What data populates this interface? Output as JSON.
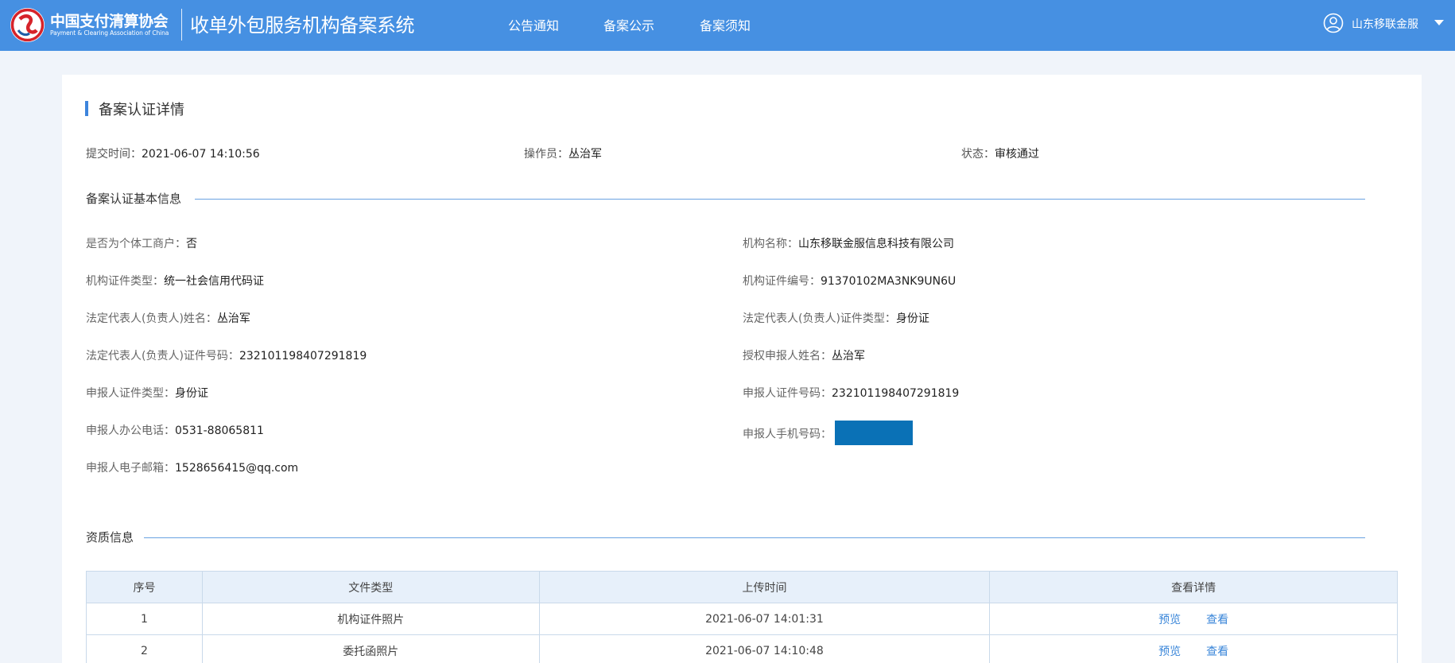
{
  "header": {
    "logo_cn": "中国支付清算协会",
    "logo_en": "Payment & Clearing Association of China",
    "system_title": "收单外包服务机构备案系统",
    "nav": [
      "公告通知",
      "备案公示",
      "备案须知"
    ],
    "user_name": "山东移联金服",
    "bg_color": "#4690e2"
  },
  "page": {
    "title": "备案认证详情",
    "meta": {
      "submit_time_label": "提交时间：",
      "submit_time": "2021-06-07 14:10:56",
      "operator_label": "操作员：",
      "operator": "丛治军",
      "status_label": "状态：",
      "status": "审核通过"
    }
  },
  "basic_info": {
    "title": "备案认证基本信息",
    "fields": {
      "is_individual": {
        "label": "是否为个体工商户：",
        "value": "否"
      },
      "org_name": {
        "label": "机构名称：",
        "value": "山东移联金服信息科技有限公司"
      },
      "org_cert_type": {
        "label": "机构证件类型：",
        "value": "统一社会信用代码证"
      },
      "org_cert_no": {
        "label": "机构证件编号：",
        "value": "91370102MA3NK9UN6U"
      },
      "legal_rep_name": {
        "label": "法定代表人(负责人)姓名：",
        "value": "丛治军"
      },
      "legal_rep_cert_type": {
        "label": "法定代表人(负责人)证件类型：",
        "value": "身份证"
      },
      "legal_rep_cert_no": {
        "label": "法定代表人(负责人)证件号码：",
        "value": "232101198407291819"
      },
      "authorized_reporter": {
        "label": "授权申报人姓名：",
        "value": "丛治军"
      },
      "reporter_cert_type": {
        "label": "申报人证件类型：",
        "value": "身份证"
      },
      "reporter_cert_no": {
        "label": "申报人证件号码：",
        "value": "232101198407291819"
      },
      "reporter_office_phone": {
        "label": "申报人办公电话：",
        "value": "0531-88065811"
      },
      "reporter_mobile": {
        "label": "申报人手机号码：",
        "value": ""
      },
      "reporter_email": {
        "label": "申报人电子邮箱：",
        "value": "1528656415@qq.com"
      }
    }
  },
  "qualification": {
    "title": "资质信息",
    "columns": [
      "序号",
      "文件类型",
      "上传时间",
      "查看详情"
    ],
    "rows": [
      {
        "no": "1",
        "type": "机构证件照片",
        "time": "2021-06-07 14:01:31",
        "preview": "预览",
        "view": "查看"
      },
      {
        "no": "2",
        "type": "委托函照片",
        "time": "2021-06-07 14:10:48",
        "preview": "预览",
        "view": "查看"
      }
    ]
  },
  "colors": {
    "accent": "#3d84dc",
    "link": "#3a86d9",
    "redaction": "#0a71b6"
  }
}
